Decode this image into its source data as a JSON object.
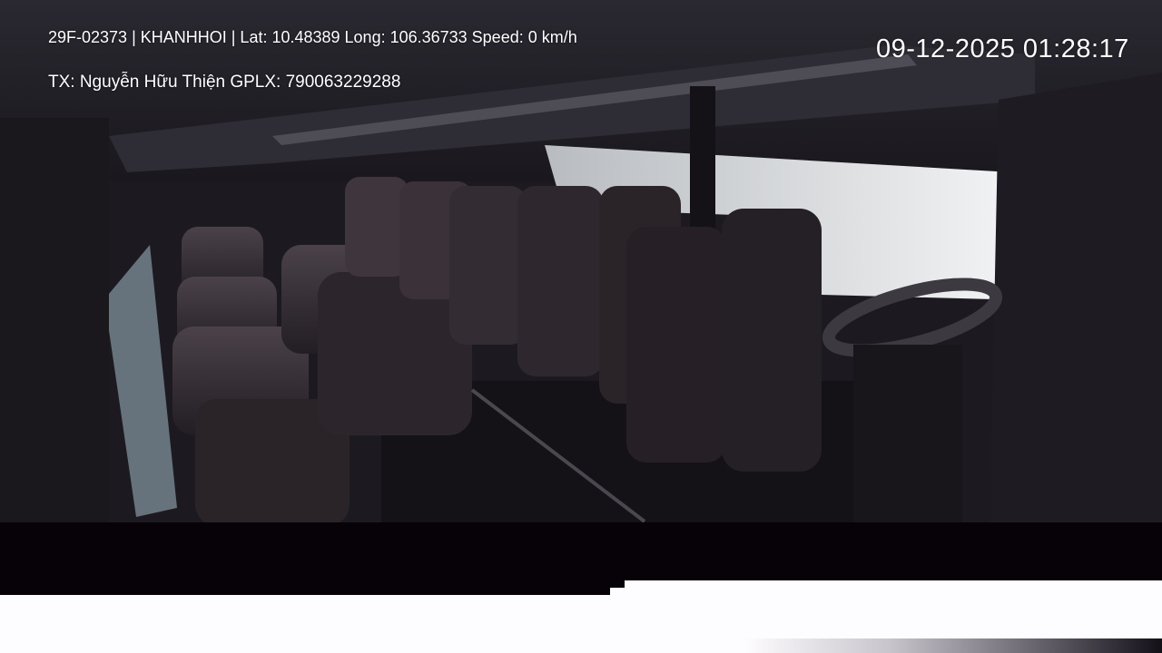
{
  "overlay": {
    "info_line": "29F-02373 | KHANHHOI | Lat: 10.48389 Long: 106.36733 Speed: 0 km/h",
    "driver_line": "TX: Nguyễn Hữu Thiện GPLX: 790063229288",
    "timestamp": "09-12-2025 01:28:17"
  },
  "scene": {
    "colors": {
      "interior": "#1c1a20",
      "seat": "#3a3238",
      "window_bright": "#e8eaec",
      "overlay_text": "#ffffff",
      "band": "#060208"
    }
  }
}
